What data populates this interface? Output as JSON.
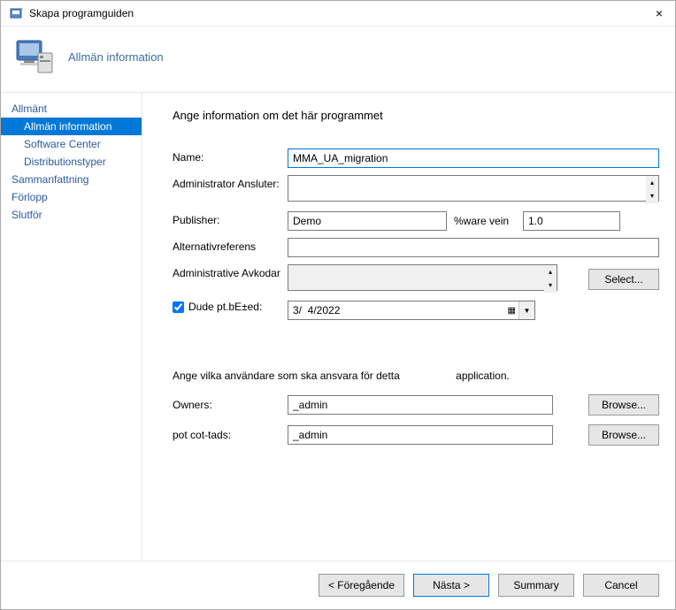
{
  "titlebar": {
    "title": "Skapa programguiden",
    "close_label": "×"
  },
  "header": {
    "page_label": "Allmän information"
  },
  "sidebar": {
    "items": [
      {
        "label": "Allmänt",
        "sub": false,
        "selected": false
      },
      {
        "label": "Allmän information",
        "sub": true,
        "selected": true
      },
      {
        "label": "Software Center",
        "sub": true,
        "selected": false
      },
      {
        "label": "Distributionstyper",
        "sub": true,
        "selected": false
      },
      {
        "label": "Sammanfattning",
        "sub": false,
        "selected": false
      },
      {
        "label": "Förlopp",
        "sub": false,
        "selected": false
      },
      {
        "label": "Slutför",
        "sub": false,
        "selected": false
      }
    ]
  },
  "content": {
    "heading": "Ange information om det här programmet",
    "labels": {
      "name": "Name:",
      "admin_comment": "Administrator Ansluter:",
      "publisher": "Publisher:",
      "sw_version": "%ware vein",
      "alt_ref": "Alternativreferens",
      "admin_categories": "Administrative Avkodar",
      "date_published": "Dude pt.bE±ed:",
      "select_btn": "Select...",
      "responsible_note": "Ange vilka användare som ska ansvara för detta",
      "responsible_note2": "application.",
      "owners": "Owners:",
      "support_contacts": "pot cot-tads:",
      "browse_btn": "Browse..."
    },
    "values": {
      "name": "MMA_UA_migration",
      "admin_comment": "",
      "publisher": "Demo",
      "sw_version": "1.0",
      "alt_ref": "",
      "admin_categories": "",
      "date_published_checked": true,
      "date_published": "3/  4/2022",
      "owners": "_admin",
      "support_contacts": "_admin"
    }
  },
  "footer": {
    "previous": "< Föregående",
    "next": "Nästa >",
    "summary": "Summary",
    "cancel": "Cancel"
  }
}
